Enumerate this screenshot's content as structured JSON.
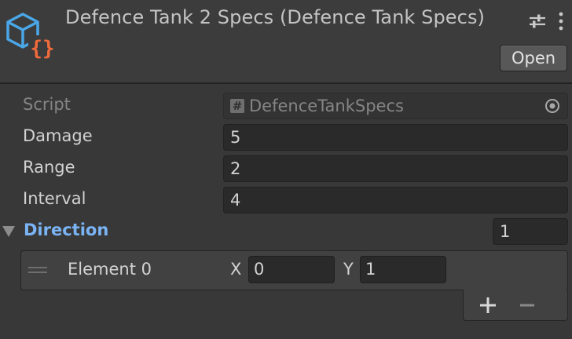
{
  "header": {
    "title": "Defence Tank 2 Specs (Defence Tank Specs)",
    "open_label": "Open",
    "icon": "scriptable-object-icon"
  },
  "properties": {
    "script": {
      "label": "Script",
      "value": "DefenceTankSpecs"
    },
    "damage": {
      "label": "Damage",
      "value": "5"
    },
    "range": {
      "label": "Range",
      "value": "2"
    },
    "interval": {
      "label": "Interval",
      "value": "4"
    }
  },
  "direction": {
    "label": "Direction",
    "size": "1",
    "elements": [
      {
        "label": "Element 0",
        "x_label": "X",
        "x": "0",
        "y_label": "Y",
        "y": "1"
      }
    ]
  },
  "colors": {
    "background": "#383838",
    "header": "#3c3c3c",
    "field": "#2a2a2a",
    "direction_label": "#7ab4f5",
    "icon_blue": "#4aa7e8",
    "icon_orange": "#f06a3c"
  }
}
